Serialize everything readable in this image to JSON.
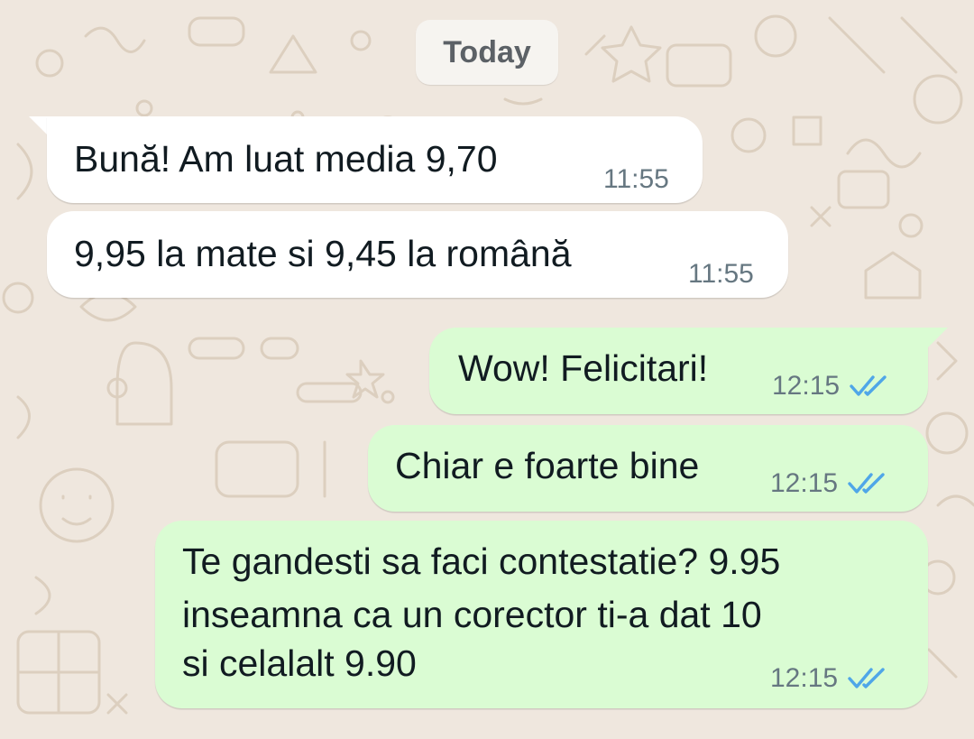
{
  "chat": {
    "date_chip": "Today",
    "messages": [
      {
        "direction": "incoming",
        "text": "Bună! Am luat media 9,70",
        "time": "11:55"
      },
      {
        "direction": "incoming",
        "text": "9,95 la mate si 9,45 la română",
        "time": "11:55"
      },
      {
        "direction": "outgoing",
        "text": "Wow! Felicitari!",
        "time": "12:15",
        "status": "read"
      },
      {
        "direction": "outgoing",
        "text": "Chiar e foarte bine",
        "time": "12:15",
        "status": "read"
      },
      {
        "direction": "outgoing",
        "lines": [
          "Te gandesti sa faci contestatie? 9.95",
          "inseamna ca un corector ti-a dat 10",
          "si celalalt 9.90"
        ],
        "time": "12:15",
        "status": "read"
      }
    ]
  },
  "colors": {
    "wallpaper": "#efe7de",
    "incoming_bubble": "#ffffff",
    "outgoing_bubble": "#dafcd3",
    "read_ticks": "#4fa6e8",
    "meta_text": "#667781"
  },
  "icons": {
    "status": "double-check-icon"
  }
}
